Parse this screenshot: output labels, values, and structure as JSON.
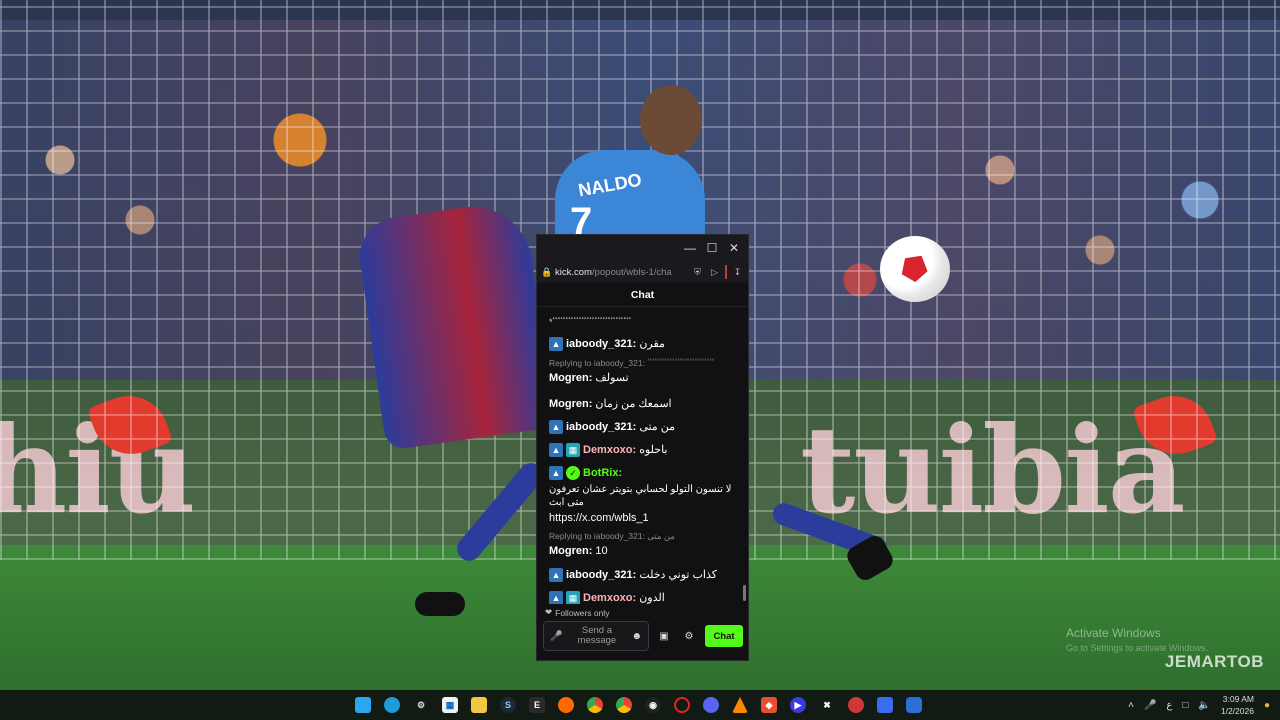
{
  "video": {
    "shirt_name": "NALDO",
    "shirt_number": "7",
    "board_text_left": "hiu",
    "board_text_right": "tuibia",
    "watermark": "JEMARTOB",
    "activate_title": "Activate Windows",
    "activate_sub": "Go to Settings to activate Windows."
  },
  "window": {
    "controls": [
      "minimize",
      "maximize",
      "close"
    ],
    "url_host": "kick.com",
    "url_path": "/popout/wbls-1/cha",
    "chat_title": "Chat"
  },
  "chat": {
    "top_line_1": "ٴٴٴٴٴٴٴٴٴٴٴٴٴٴٴٴٴٴٴٴٴٴٴٴٴٴٴٴٴٴٴٴٴٴٴٴٴٴٴٴٴٴ",
    "top_line_2": "*ٴٴٴٴٴٴٴٴٴٴٴٴٴٴٴٴٴٴٴٴٴٴٴٴٴٴٴٴٴٴ",
    "messages": [
      {
        "user": "iaboody_321:",
        "text": "مقرن",
        "user_color": "#ffffff"
      },
      {
        "reply": "Replying to iaboody_321: ٴٴٴٴٴٴٴٴٴٴٴٴٴٴٴٴٴٴٴٴٴٴٴٴٴٴٴ",
        "user": "Mogren:",
        "text": "تسولف",
        "user_color": "#ffffff"
      },
      {
        "user": "Mogren:",
        "text": "اسمعك من زمان",
        "user_color": "#ffffff"
      },
      {
        "user": "iaboody_321:",
        "text": "من متى",
        "user_color": "#ffffff"
      },
      {
        "user": "Demxoxo:",
        "text": "باحلوه",
        "user_color": "#ffb3b3"
      },
      {
        "user": "BotRix:",
        "text": "لا تنسون التولو لحسابي بتويتر عشان تعرفون متى ابث",
        "link": "https://x.com/wbls_1",
        "user_color": "#53fc18"
      },
      {
        "reply": "Replying to iaboody_321: من متى",
        "user": "Mogren:",
        "text": "10",
        "user_color": "#ffffff"
      },
      {
        "user": "iaboody_321:",
        "text": "كذاب توني دخلت",
        "user_color": "#ffffff"
      },
      {
        "user": "Demxoxo:",
        "text": "الدون",
        "user_color": "#ffb3b3"
      }
    ],
    "followers_only": "Followers only",
    "placeholder_line1": "Send a",
    "placeholder_line2": "message",
    "send_label": "Chat"
  },
  "taskbar": {
    "apps": [
      "windows",
      "edge",
      "settings",
      "store",
      "explorer",
      "steam",
      "epic",
      "soundcloud",
      "chrome",
      "chrome-alt",
      "ubisoft",
      "opera",
      "discord",
      "vlc",
      "git",
      "media-player",
      "capcut",
      "riot",
      "dotnet",
      "skype"
    ],
    "tray_lang": "ع",
    "time": "3:09 AM",
    "date": "1/2/2026"
  },
  "colors": {
    "kick_green": "#53fc18",
    "chat_bg": "#111114"
  }
}
